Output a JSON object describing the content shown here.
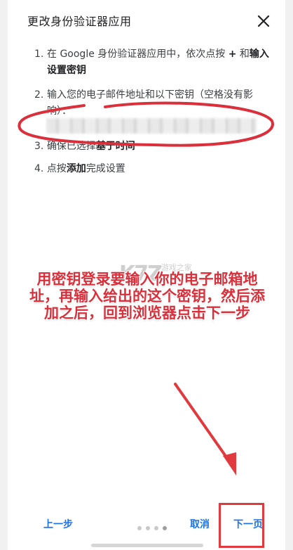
{
  "dialog": {
    "title": "更改身份验证器应用",
    "close_icon": "close-icon"
  },
  "steps": [
    {
      "num": "1.",
      "text_a": "在 Google 身份验证器应用中，依次点按 ",
      "bold_a": "+",
      "text_b": " 和",
      "bold_b": "输入设置密钥"
    },
    {
      "num": "2.",
      "text": "输入您的电子邮件地址和以下密钥（空格没有影响）："
    },
    {
      "num": "3.",
      "text": "确保已选择",
      "bold": "基于时间"
    },
    {
      "num": "4.",
      "text_a": "点按",
      "bold": "添加",
      "text_b": "完成设置"
    }
  ],
  "annotation": "用密钥登录要输入你的电子邮箱地址，再输入给出的这个密钥，然后添加之后，回到浏览器点击下一步",
  "watermark": {
    "text": "K7Z",
    "sub": "游戏之家"
  },
  "footer": {
    "prev_label": "上一步",
    "cancel_label": "取消",
    "next_label": "下一页"
  },
  "pager": {
    "total": 4,
    "active": 3
  },
  "colors": {
    "accent": "#1a73e8",
    "annotation": "#d9303b"
  }
}
